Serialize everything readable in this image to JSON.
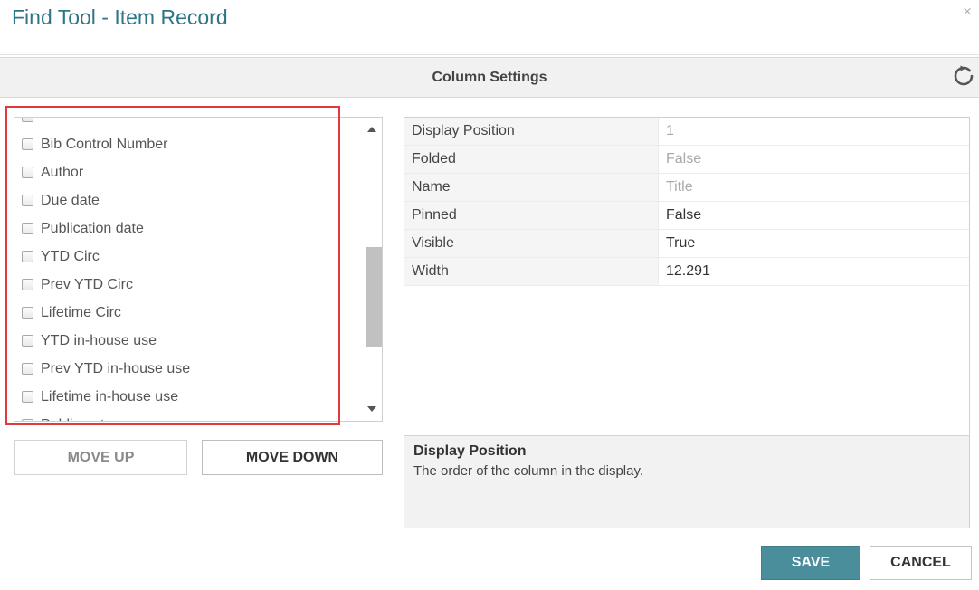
{
  "dialog": {
    "title": "Find Tool - Item Record",
    "close_icon": "×"
  },
  "settings_bar": {
    "title": "Column Settings",
    "reset_icon": "refresh-icon"
  },
  "column_list": {
    "items": [
      {
        "label": "",
        "checked": false
      },
      {
        "label": "Bib Control Number",
        "checked": false
      },
      {
        "label": "Author",
        "checked": false
      },
      {
        "label": "Due date",
        "checked": false
      },
      {
        "label": "Publication date",
        "checked": false
      },
      {
        "label": "YTD Circ",
        "checked": false
      },
      {
        "label": "Prev YTD Circ",
        "checked": false
      },
      {
        "label": "Lifetime Circ",
        "checked": false
      },
      {
        "label": "YTD in-house use",
        "checked": false
      },
      {
        "label": "Prev YTD in-house use",
        "checked": false
      },
      {
        "label": "Lifetime in-house use",
        "checked": false
      },
      {
        "label": "Public notes",
        "checked": false
      }
    ]
  },
  "buttons": {
    "move_up": "MOVE UP",
    "move_down": "MOVE DOWN",
    "save": "SAVE",
    "cancel": "CANCEL"
  },
  "properties": [
    {
      "label": "Display Position",
      "value": "1",
      "readonly": true
    },
    {
      "label": "Folded",
      "value": "False",
      "readonly": true
    },
    {
      "label": "Name",
      "value": "Title",
      "readonly": true
    },
    {
      "label": "Pinned",
      "value": "False",
      "readonly": false
    },
    {
      "label": "Visible",
      "value": "True",
      "readonly": false
    },
    {
      "label": "Width",
      "value": "12.291",
      "readonly": false
    }
  ],
  "description": {
    "title": "Display Position",
    "text": "The order of the column in the display."
  },
  "colors": {
    "title": "#2e7588",
    "save_button": "#4a8e9c",
    "highlight": "#e0393e"
  }
}
